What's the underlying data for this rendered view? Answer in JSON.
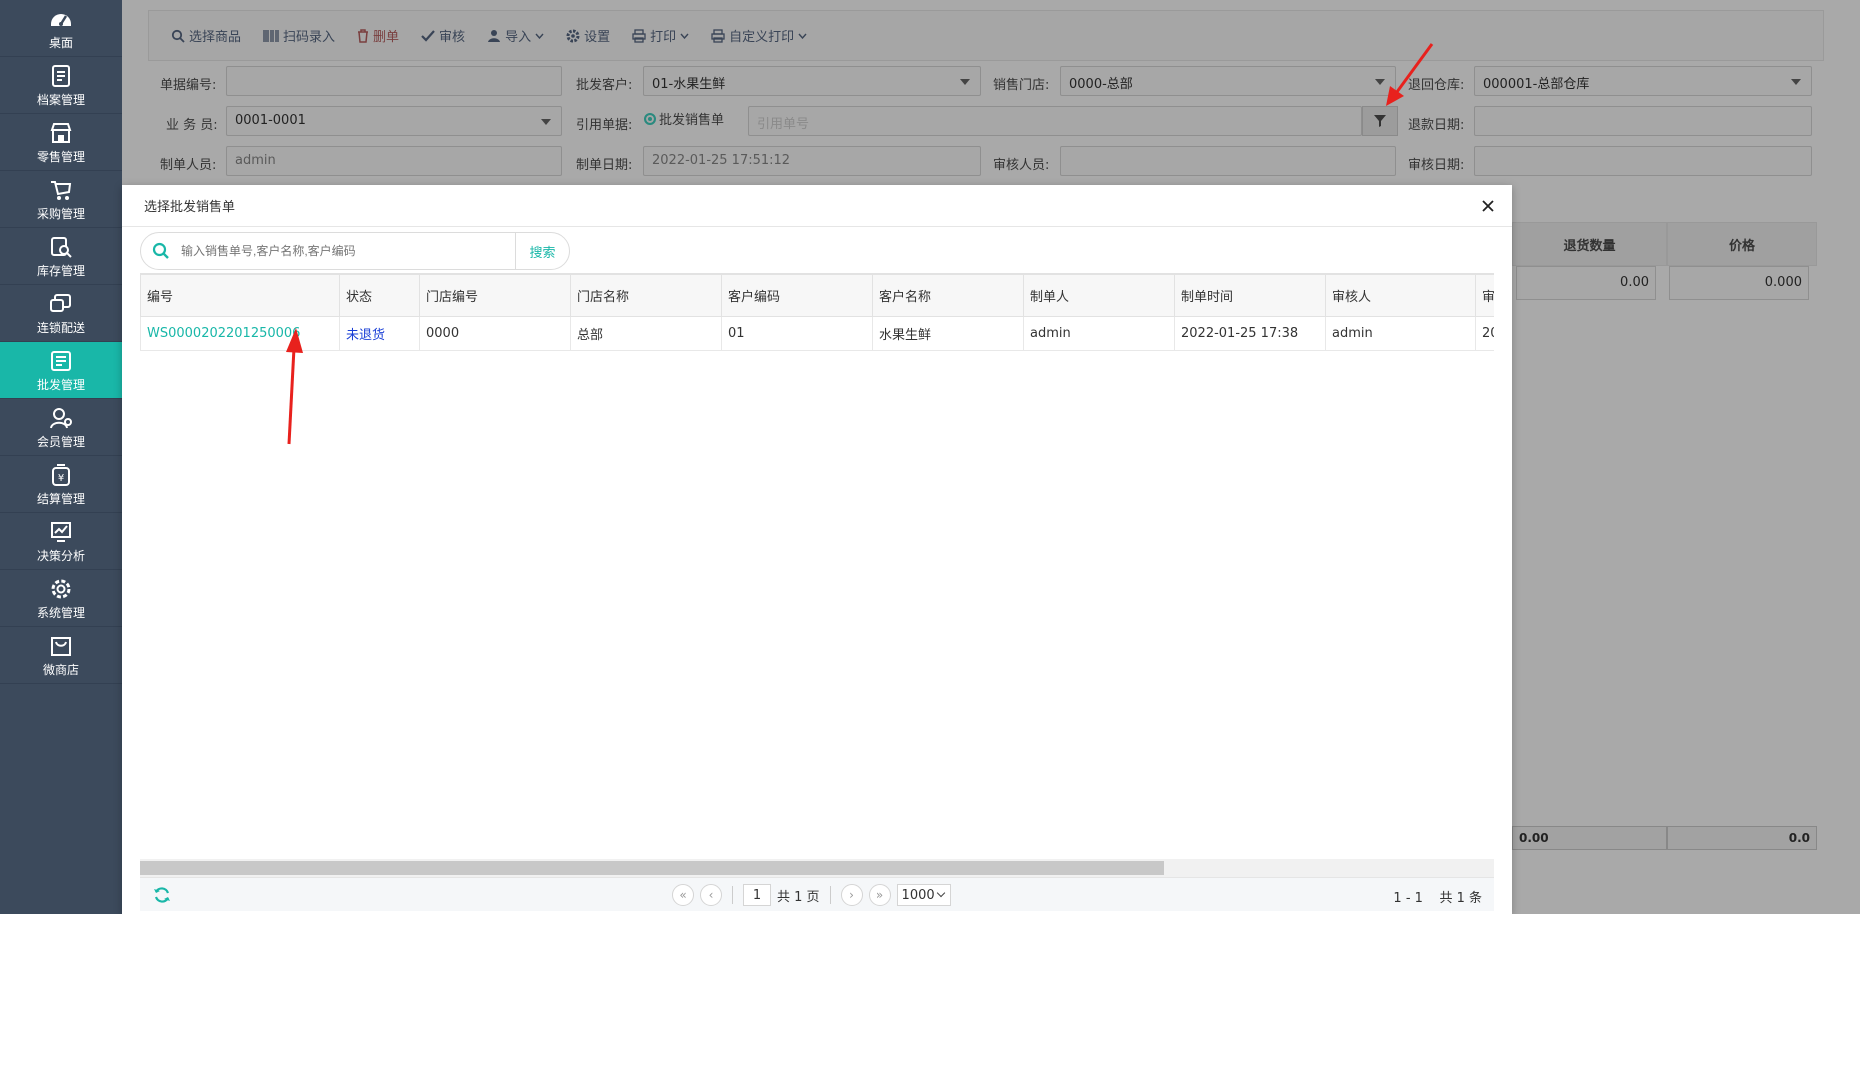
{
  "sidebar": {
    "items": [
      {
        "label": "桌面",
        "icon": "dashboard-icon"
      },
      {
        "label": "档案管理",
        "icon": "archive-icon"
      },
      {
        "label": "零售管理",
        "icon": "store-icon"
      },
      {
        "label": "采购管理",
        "icon": "purchase-icon"
      },
      {
        "label": "库存管理",
        "icon": "inventory-icon"
      },
      {
        "label": "连锁配送",
        "icon": "delivery-icon"
      },
      {
        "label": "批发管理",
        "icon": "wholesale-icon",
        "active": true
      },
      {
        "label": "会员管理",
        "icon": "member-icon"
      },
      {
        "label": "结算管理",
        "icon": "settlement-icon"
      },
      {
        "label": "决策分析",
        "icon": "analysis-icon"
      },
      {
        "label": "系统管理",
        "icon": "settings-icon"
      },
      {
        "label": "微商店",
        "icon": "shop-icon"
      }
    ]
  },
  "toolbar": {
    "select_goods": "选择商品",
    "scan_input": "扫码录入",
    "delete": "删单",
    "audit": "审核",
    "import": "导入",
    "settings": "设置",
    "print": "打印",
    "custom_print": "自定义打印"
  },
  "form": {
    "doc_no_label": "单据编号:",
    "doc_no_value": "",
    "customer_label": "批发客户:",
    "customer_value": "01-水果生鲜",
    "store_label": "销售门店:",
    "store_value": "0000-总部",
    "warehouse_label": "退回仓库:",
    "warehouse_value": "000001-总部仓库",
    "salesman_label": "业 务 员:",
    "salesman_value": "0001-0001",
    "ref_label": "引用单据:",
    "ref_radio_label": "批发销售单",
    "ref_placeholder": "引用单号",
    "refund_date_label": "退款日期:",
    "refund_date_value": "",
    "maker_label": "制单人员:",
    "maker_value": "admin",
    "make_date_label": "制单日期:",
    "make_date_value": "2022-01-25 17:51:12",
    "auditor_label": "审核人员:",
    "auditor_value": "",
    "audit_date_label": "审核日期:",
    "audit_date_value": ""
  },
  "bg_grid": {
    "col_qty": "退货数量",
    "col_price": "价格",
    "qty_value": "0.00",
    "price_value": "0.000",
    "footer_qty": "0.00",
    "footer_price": "0.0"
  },
  "dialog": {
    "title": "选择批发销售单",
    "search_placeholder": "输入销售单号,客户名称,客户编码",
    "search_button": "搜索",
    "columns": [
      "编号",
      "状态",
      "门店编号",
      "门店名称",
      "客户编码",
      "客户名称",
      "制单人",
      "制单时间",
      "审核人",
      "审"
    ],
    "rows": [
      [
        "WS0000202201250006",
        "未退货",
        "0000",
        "总部",
        "01",
        "水果生鲜",
        "admin",
        "2022-01-25 17:38",
        "admin",
        "20"
      ]
    ],
    "pager": {
      "page": "1",
      "total_pages": "共 1 页",
      "page_size": "1000",
      "range": "1 - 1",
      "total": "共 1 条"
    }
  },
  "colors": {
    "accent": "#19b7a8",
    "sidebar": "#3c4a5c",
    "annotation_arrow": "#e8211d"
  }
}
